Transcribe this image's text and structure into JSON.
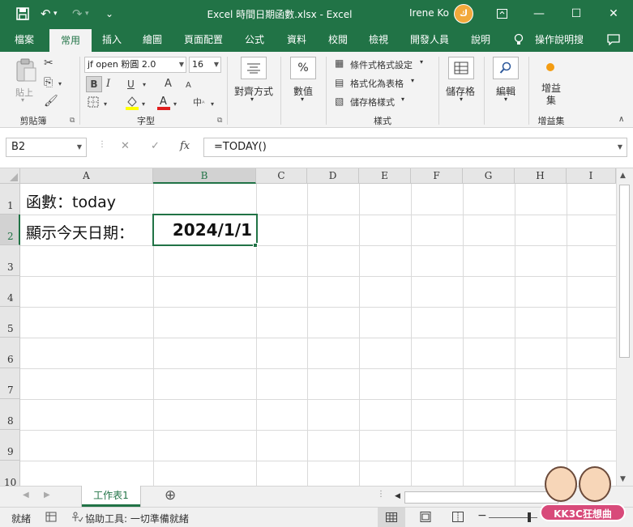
{
  "titlebar": {
    "title": "Excel 時間日期函數.xlsx  -  Excel",
    "user": "Irene Ko",
    "avatar": "ك",
    "save_icon": "save-icon",
    "undo": "↶",
    "redo": "↷",
    "customize": "⌄"
  },
  "tabs": [
    "檔案",
    "常用",
    "插入",
    "繪圖",
    "頁面配置",
    "公式",
    "資料",
    "校閱",
    "檢視",
    "開發人員",
    "說明",
    "操作說明搜"
  ],
  "ribbon": {
    "paste": "貼上",
    "clipboard": "剪貼簿",
    "font_name": "jf open 粉圓 2.0",
    "font_size": "16",
    "bold": "B",
    "italic": "I",
    "underline": "U",
    "grow": "A",
    "shrink": "A",
    "font_group": "字型",
    "align": "對齊方式",
    "number": "數值",
    "number_icon": "%",
    "cond_format": "條件式格式設定",
    "format_table": "格式化為表格",
    "cell_styles": "儲存格樣式",
    "styles_group": "樣式",
    "cells": "儲存格",
    "editing": "編輯",
    "addin": "增益集",
    "addin_group": "增益集"
  },
  "formula_bar": {
    "name_box": "B2",
    "cancel": "✕",
    "enter": "✓",
    "fx": "fx",
    "formula": "=TODAY()"
  },
  "columns": [
    "A",
    "B",
    "C",
    "D",
    "E",
    "F",
    "G",
    "H",
    "I"
  ],
  "rows": [
    "1",
    "2",
    "3",
    "4",
    "5",
    "6",
    "7",
    "8",
    "9",
    "10"
  ],
  "cells": {
    "A1": "函數：today",
    "A2": "顯示今天日期：",
    "B2": "2024/1/1"
  },
  "sheet": {
    "tab": "工作表1",
    "add": "⊕"
  },
  "status": {
    "ready": "就緒",
    "accessibility": "協助工具: 一切準備就緒"
  },
  "watermark": "KK3C狂想曲",
  "colors": {
    "accent": "#217346"
  }
}
